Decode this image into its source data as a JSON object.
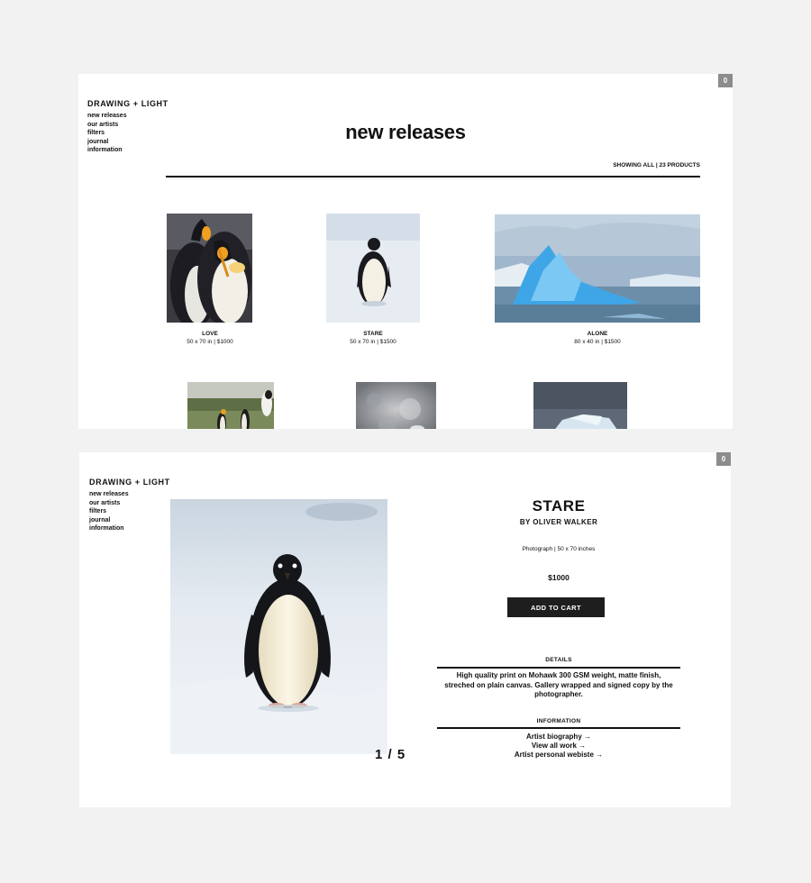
{
  "brand": "DRAWING + LIGHT",
  "nav": [
    "new releases",
    "our artists",
    "filters",
    "journal",
    "information"
  ],
  "cart_count": "0",
  "listing": {
    "title": "new releases",
    "showing": "SHOWING ALL | 23 PRODUCTS",
    "products": [
      {
        "name": "LOVE",
        "info": "50 x 70 in | $1000"
      },
      {
        "name": "STARE",
        "info": "50 x 70 in | $1500"
      },
      {
        "name": "ALONE",
        "info": "80 x 40 in | $1500"
      }
    ]
  },
  "detail": {
    "title": "STARE",
    "artist": "BY  OLIVER WALKER",
    "meta": "Photograph  |  50 x 70 inches",
    "price": "$1000",
    "cart_button": "ADD TO CART",
    "counter": "1 / 5",
    "details_heading": "DETAILS",
    "details_text": "High quality print on Mohawk 300 GSM weight, matte finish, streched on plain canvas. Gallery wrapped and signed copy by the photographer.",
    "info_heading": "INFORMATION",
    "info_links": [
      "Artist biography →",
      "View all work →",
      "Artist personal webiste →"
    ]
  },
  "colors": {
    "background": "#f2f2f2",
    "panel": "#ffffff",
    "button": "#1e1e1e",
    "badge": "#8c8c8c"
  }
}
